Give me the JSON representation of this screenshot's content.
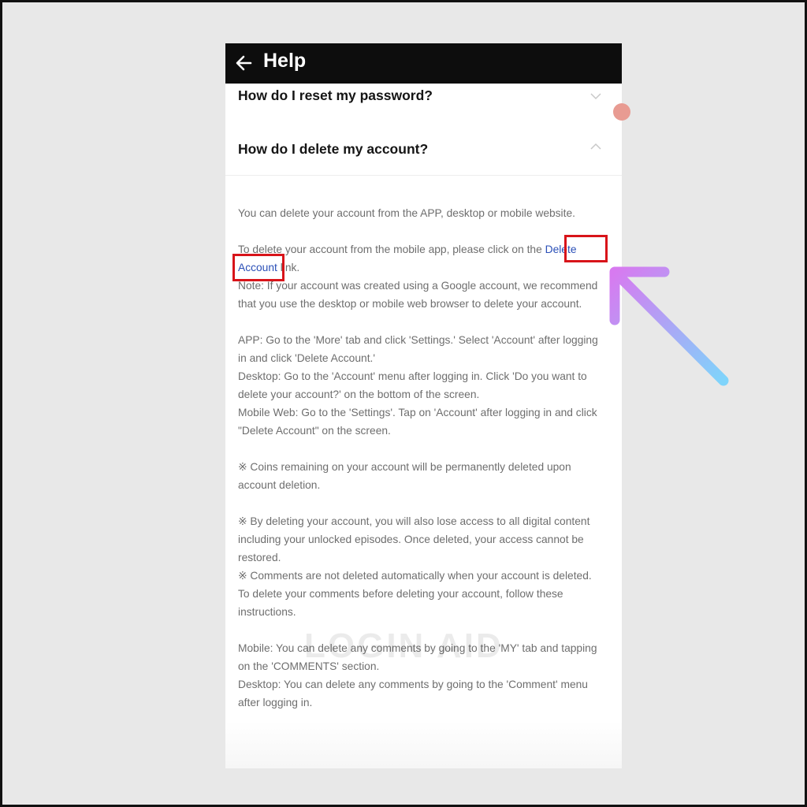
{
  "header": {
    "back_icon": "arrow-left-icon",
    "title": "Help"
  },
  "faq": [
    {
      "question": "How do I reset my password?",
      "state": "collapsed",
      "icon": "chevron-down-icon"
    },
    {
      "question": "How do I delete my account?",
      "state": "expanded",
      "icon": "chevron-up-icon"
    }
  ],
  "answer": {
    "intro": "You can delete your account from the APP, desktop or mobile website.",
    "link_pre": "To delete your account from the mobile app, please click on the ",
    "link_word1": "Delete",
    "link_word2": "Account",
    "link_post": " link.",
    "note": "Note: If your account was created using a Google account, we recommend that you use the desktop or mobile web browser to delete your account.",
    "app_steps": "APP: Go to the 'More' tab and click 'Settings.' Select 'Account' after logging in and click 'Delete Account.'",
    "desktop_steps": "Desktop: Go to the 'Account' menu after logging in. Click 'Do you want to delete your account?' on the bottom of the screen.",
    "mobile_web_steps": "Mobile Web: Go to the 'Settings'. Tap on 'Account' after logging in and click \"Delete Account\" on the screen.",
    "coins_note": "※ Coins remaining on your account will be permanently deleted upon account deletion.",
    "access_note": "※ By deleting your account, you will also lose access to all digital content including your unlocked episodes. Once deleted, your access cannot be restored.",
    "comments_note": "※ Comments are not deleted automatically when your account is deleted. To delete your comments before deleting your account, follow these instructions.",
    "mobile_comments": "Mobile: You can delete any comments by going to the 'MY' tab and tapping on the 'COMMENTS' section.",
    "desktop_comments": "Desktop: You can delete any comments by going to the 'Comment' menu after logging in."
  },
  "watermark": "LOGIN AID",
  "annotation": {
    "highlight_color": "#d8141a",
    "arrow_icon": "gradient-arrow-pointer",
    "arrow_colors": [
      "#d77af0",
      "#7fd4fb"
    ]
  }
}
